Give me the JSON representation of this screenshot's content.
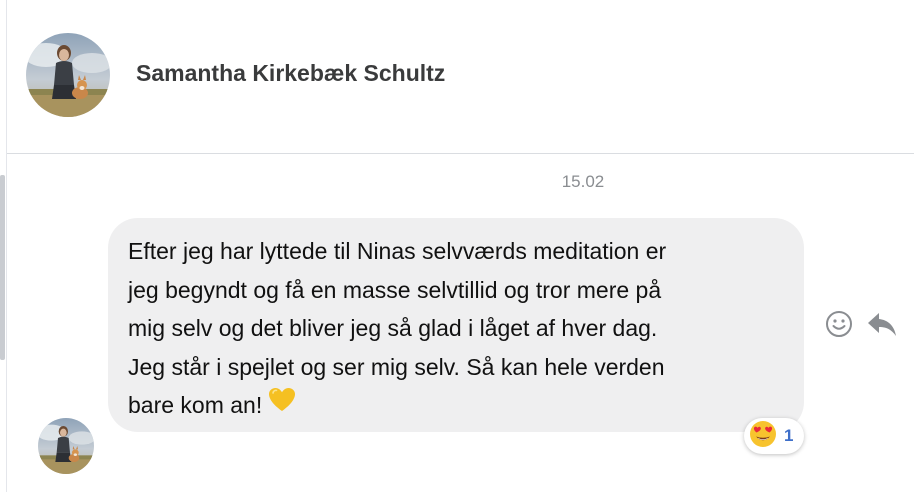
{
  "header": {
    "contact_name": "Samantha Kirkebæk Schultz",
    "avatar_icon": "profile-photo-avatar"
  },
  "conversation": {
    "timestamp": "15.02",
    "message": {
      "lines": [
        "Efter jeg har lyttede til Ninas selvværds meditation er",
        "jeg begyndt og få en masse selvtillid og tror mere på",
        "mig selv og det bliver jeg så glad i låget af hver dag.",
        "Jeg står i spejlet og ser mig selv. Så kan hele verden",
        "bare kom an!"
      ],
      "inline_emoji": "yellow-heart-icon",
      "reaction": {
        "emoji": "heart-eyes-emoji-icon",
        "count": "1"
      }
    },
    "actions": {
      "react_icon": "smiley-face-icon",
      "reply_icon": "reply-arrow-icon"
    }
  },
  "colors": {
    "bubble": "#efeff0",
    "name_text": "#3a3b3c",
    "timestamp_text": "#8a8d91",
    "reaction_count": "#3e6fc9",
    "icon_gray": "#8a8d91"
  }
}
